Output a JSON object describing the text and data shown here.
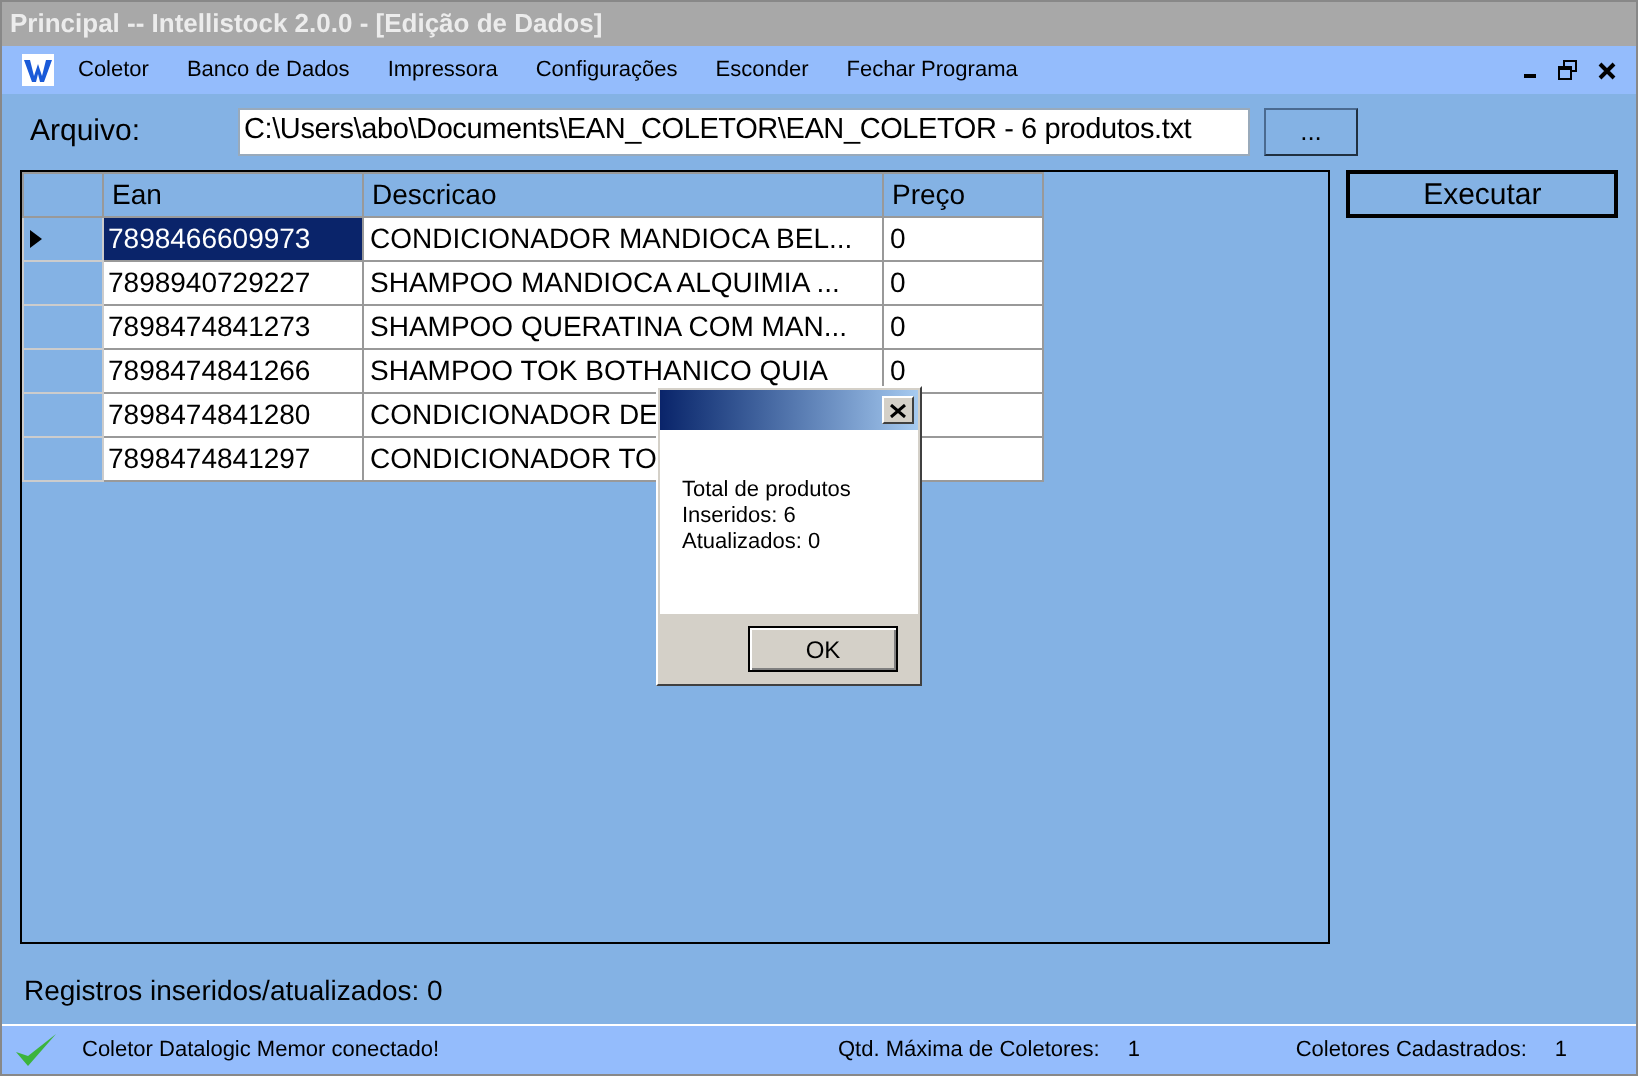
{
  "window": {
    "title": "Principal -- Intellistock 2.0.0 - [Edição de Dados]"
  },
  "menu": [
    "Coletor",
    "Banco de Dados",
    "Impressora",
    "Configurações",
    "Esconder",
    "Fechar Programa"
  ],
  "file": {
    "label": "Arquivo:",
    "value": "C:\\Users\\abo\\Documents\\EAN_COLETOR\\EAN_COLETOR - 6 produtos.txt",
    "browse": "..."
  },
  "execute": "Executar",
  "table": {
    "columns": [
      "Ean",
      "Descricao",
      "Preço"
    ],
    "rows": [
      {
        "ean": "7898466609973",
        "desc": "CONDICIONADOR MANDIOCA BEL...",
        "price": "0",
        "selected": true
      },
      {
        "ean": "7898940729227",
        "desc": "SHAMPOO MANDIOCA ALQUIMIA ...",
        "price": "0",
        "selected": false
      },
      {
        "ean": "7898474841273",
        "desc": "SHAMPOO QUERATINA COM MAN...",
        "price": "0",
        "selected": false
      },
      {
        "ean": "7898474841266",
        "desc": "SHAMPOO TOK BOTHANICO QUIA",
        "price": "0",
        "selected": false
      },
      {
        "ean": "7898474841280",
        "desc": "CONDICIONADOR DE",
        "selected": false
      },
      {
        "ean": "7898474841297",
        "desc": "CONDICIONADOR TO",
        "selected": false
      }
    ]
  },
  "records": "Registros inseridos/atualizados: 0",
  "dialog": {
    "lines": [
      "Total de produtos",
      "Inseridos: 6",
      "Atualizados: 0"
    ],
    "ok": "OK"
  },
  "status_bar": {
    "message": "Coletor Datalogic Memor conectado!",
    "max_label": "Qtd. Máxima de Coletores:",
    "max_value": "1",
    "reg_label": "Coletores Cadastrados:",
    "reg_value": "1"
  }
}
